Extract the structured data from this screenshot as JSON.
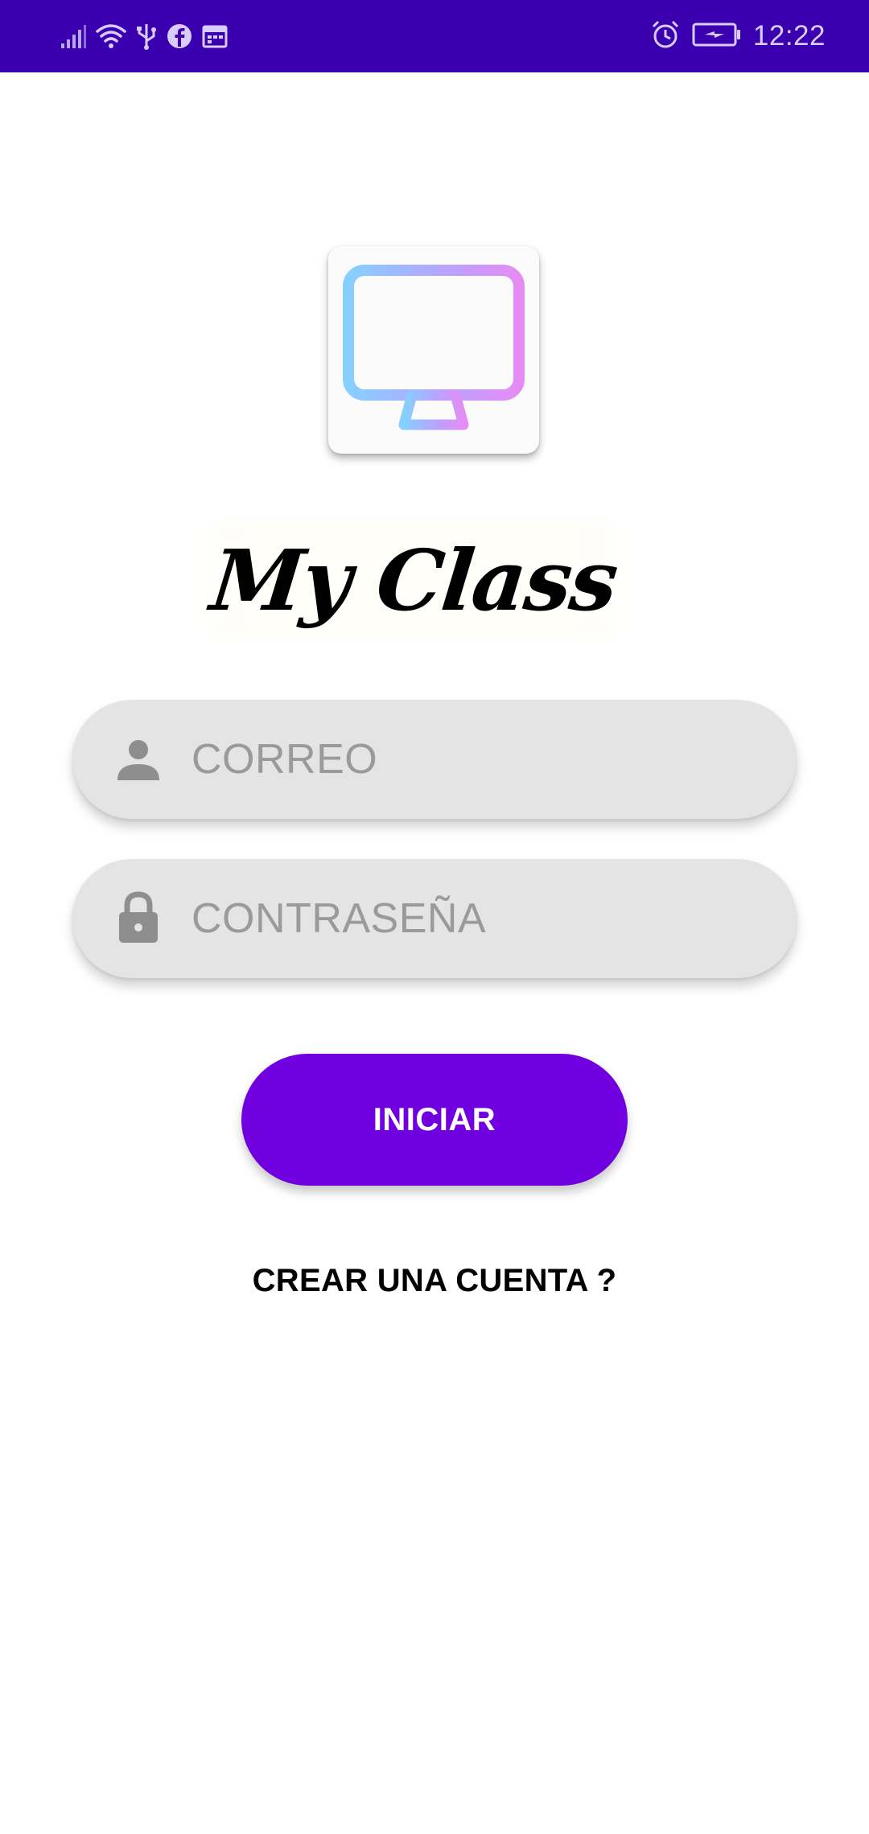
{
  "status_bar": {
    "time": "12:22",
    "background_color": "#3a00b0",
    "left_icons": [
      "signal-icon",
      "wifi-icon",
      "usb-icon",
      "facebook-icon",
      "calendar-icon"
    ],
    "right_icons": [
      "alarm-icon",
      "battery-charging-icon"
    ]
  },
  "app": {
    "logo_icon": "monitor-icon",
    "name": "My Class"
  },
  "login_form": {
    "email": {
      "icon": "person-icon",
      "placeholder": "CORREO",
      "value": ""
    },
    "password": {
      "icon": "lock-icon",
      "placeholder": "CONTRASEÑA",
      "value": ""
    },
    "submit_label": "INICIAR",
    "submit_color": "#7000e0",
    "signup_link": "CREAR UNA CUENTA ?"
  }
}
